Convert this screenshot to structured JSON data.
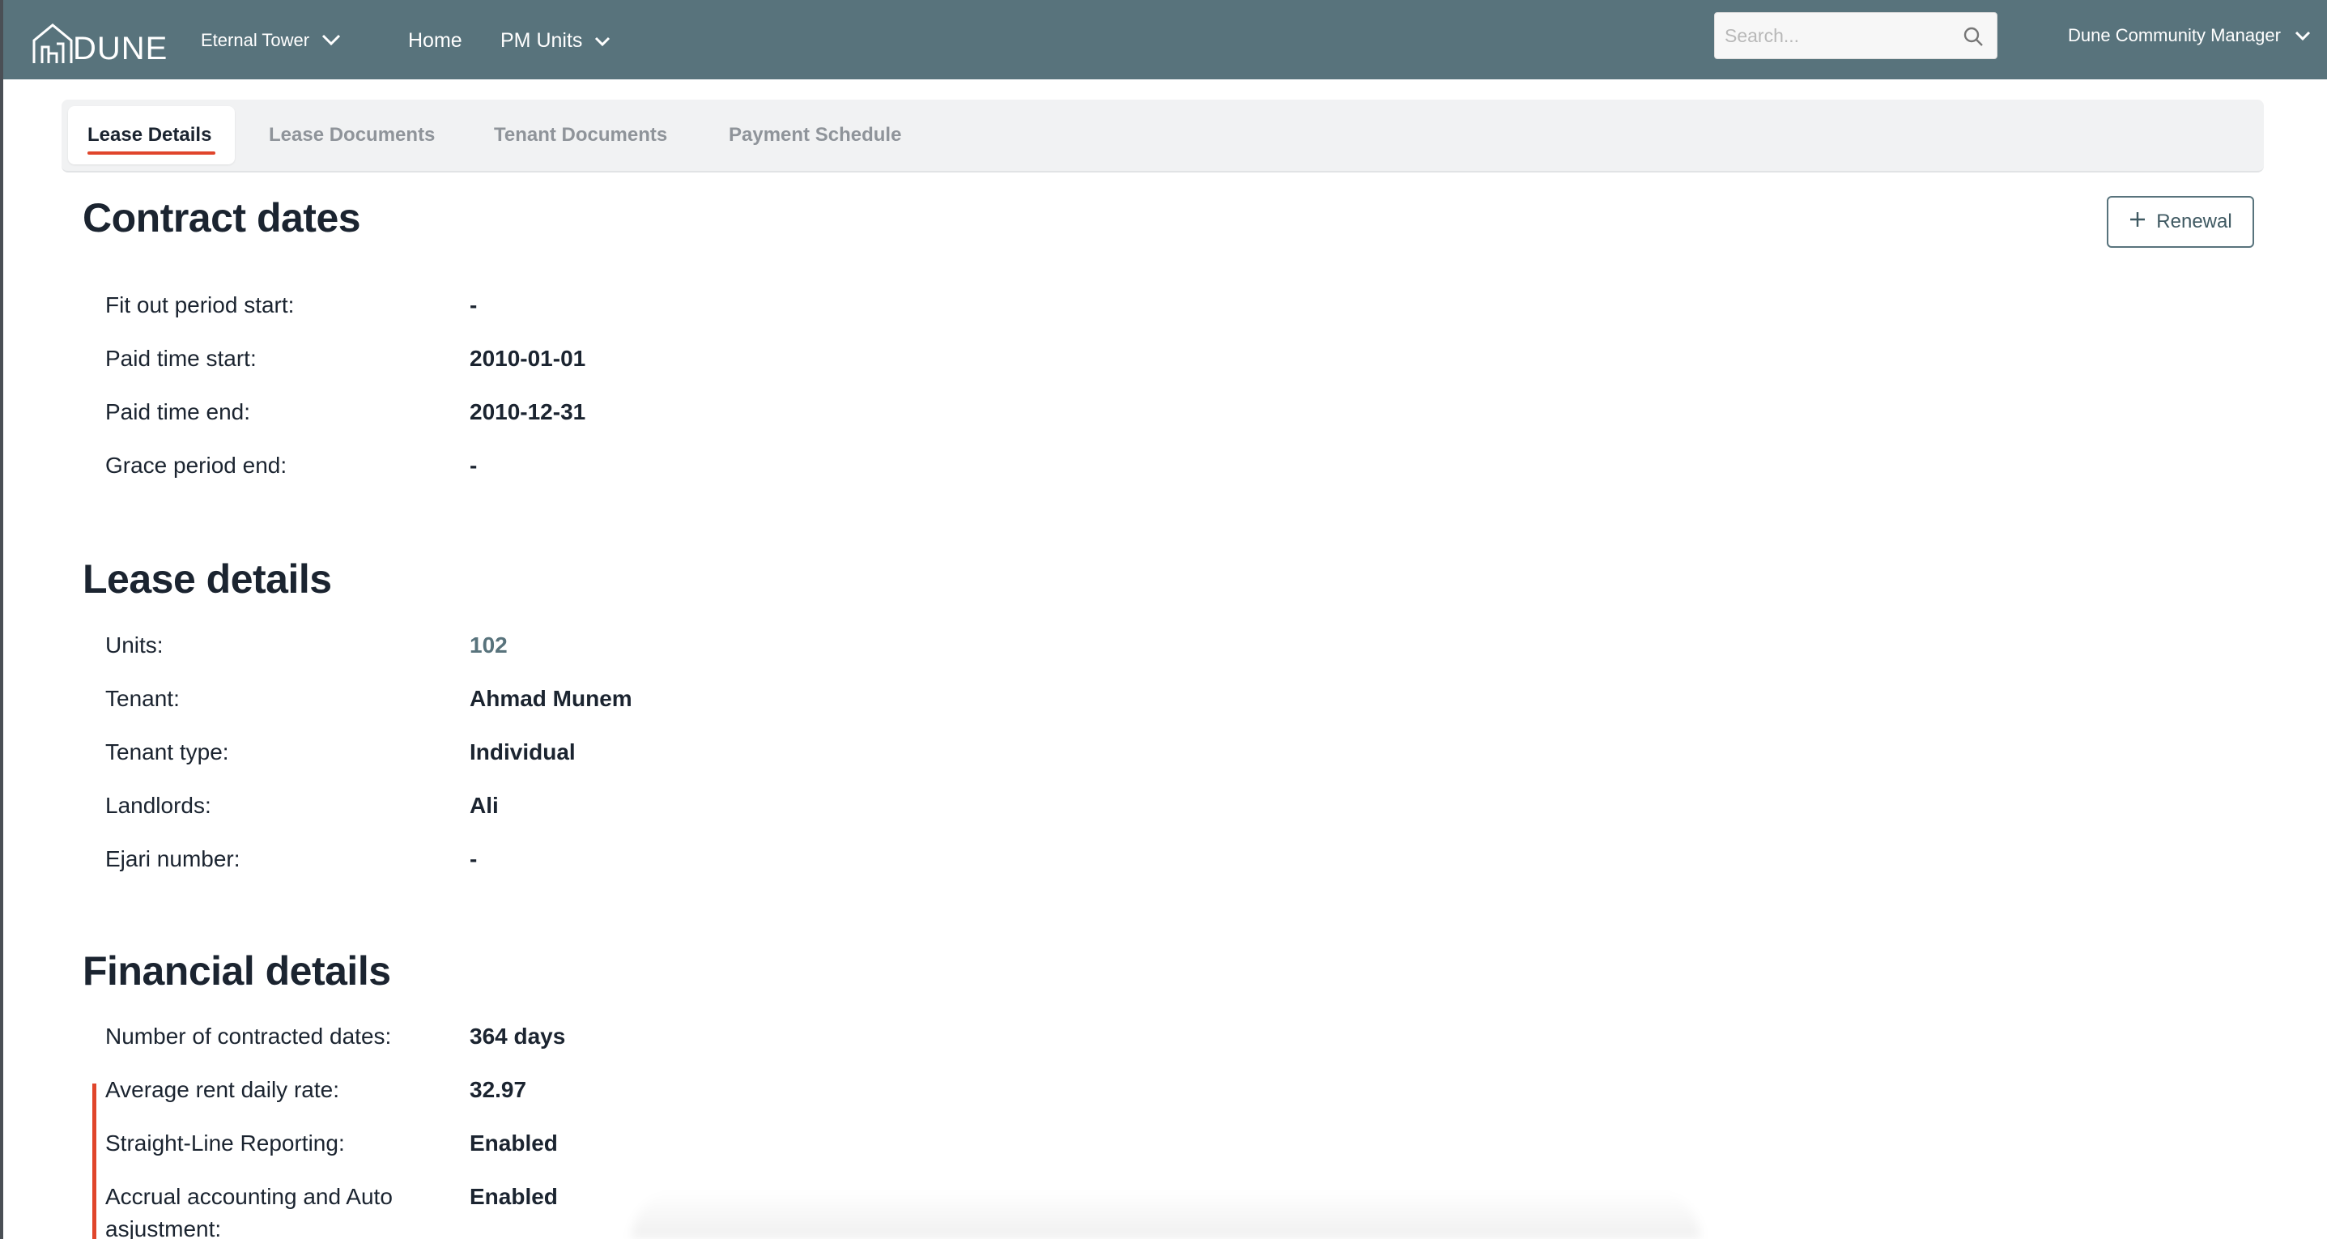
{
  "app": {
    "logo_text": "DUNE",
    "brand_color": "#58737c",
    "accent_color": "#e0452b"
  },
  "nav": {
    "building": "Eternal Tower",
    "home": "Home",
    "pm_units": "PM Units",
    "user": "Dune Community Manager"
  },
  "search": {
    "placeholder": "Search...",
    "value": ""
  },
  "tabs": [
    {
      "label": "Lease Details",
      "active": true
    },
    {
      "label": "Lease Documents",
      "active": false
    },
    {
      "label": "Tenant Documents",
      "active": false
    },
    {
      "label": "Payment Schedule",
      "active": false
    }
  ],
  "contract_dates": {
    "title": "Contract dates",
    "renewal_label": "Renewal",
    "rows": [
      {
        "label": "Fit out period start:",
        "value": "-"
      },
      {
        "label": "Paid time start:",
        "value": "2010-01-01"
      },
      {
        "label": "Paid time end:",
        "value": "2010-12-31"
      },
      {
        "label": "Grace period end:",
        "value": "-"
      }
    ]
  },
  "lease_details": {
    "title": "Lease details",
    "rows": [
      {
        "label": "Units:",
        "value": "102"
      },
      {
        "label": "Tenant:",
        "value": "Ahmad Munem"
      },
      {
        "label": "Tenant type:",
        "value": "Individual"
      },
      {
        "label": "Landlords:",
        "value": "Ali"
      },
      {
        "label": "Ejari number:",
        "value": "-"
      }
    ]
  },
  "financial_details": {
    "title": "Financial details",
    "rows": [
      {
        "label": "Number of contracted dates:",
        "value": "364 days"
      },
      {
        "label": "Average rent daily rate:",
        "value": "32.97"
      },
      {
        "label": "Straight-Line Reporting:",
        "value": "Enabled"
      },
      {
        "label": "Accrual accounting and Auto",
        "label_cont": "asjustment:",
        "value": "Enabled"
      }
    ]
  }
}
